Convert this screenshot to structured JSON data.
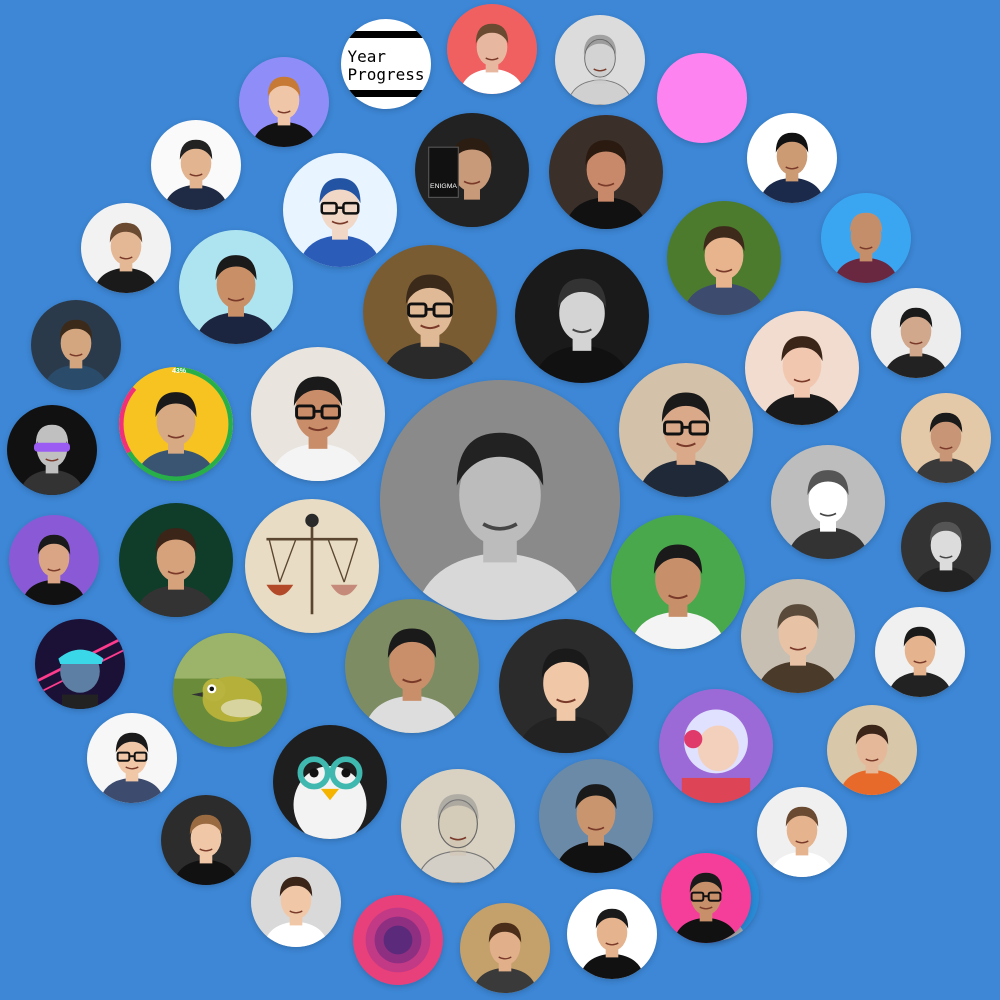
{
  "page": {
    "background": "#3d87d6"
  },
  "year_progress": {
    "line1": "Year",
    "line2": "Progress"
  },
  "ring_badge": "43%",
  "enigma_book": "ENIGMA",
  "avatars": [
    {
      "id": "center-portrait",
      "label": "profile-photo",
      "bg": "#8a8a8a",
      "skin": "#bcbcbc",
      "hair": "#222",
      "shirt": "#d8d8d8",
      "bw": true
    },
    {
      "id": "portrait-01",
      "bg": "#fafafa",
      "skin": "#e2b48f",
      "hair": "#222",
      "shirt": "#1f2b45"
    },
    {
      "id": "portrait-02",
      "bg": "#f06060",
      "skin": "#e7b7a0",
      "hair": "#6b4a32",
      "shirt": "#fff"
    },
    {
      "id": "portrait-03",
      "bg": "#dcdcdc",
      "skin": "#c9c9c9",
      "hair": "#666",
      "shirt": "#bbb",
      "sketch": true
    },
    {
      "id": "portrait-04",
      "bg": "#fc83f0",
      "flat": true
    },
    {
      "id": "portrait-05",
      "bg": "#8f8df7",
      "skin": "#f0c6a8",
      "hair": "#c77a35",
      "shirt": "#111"
    },
    {
      "id": "portrait-06",
      "bg": "#ffffff",
      "skin": "#cc9a73",
      "hair": "#111",
      "shirt": "#1b2a4a"
    },
    {
      "id": "portrait-07",
      "bg": "#e8f4ff",
      "skin": "#f1d7c6",
      "hair": "#2254a3",
      "shirt": "#2b5cb8",
      "glasses": true
    },
    {
      "id": "portrait-08",
      "bg": "#222",
      "skin": "#c99a7a",
      "hair": "#2b1d12",
      "shirt": "#222",
      "enigma": true
    },
    {
      "id": "portrait-09",
      "bg": "#3b2f2a",
      "skin": "#c7896a",
      "hair": "#2a1a10",
      "shirt": "#111"
    },
    {
      "id": "portrait-10",
      "bg": "#f2f2f2",
      "skin": "#e5b895",
      "hair": "#6b4a32",
      "shirt": "#1a1a1a"
    },
    {
      "id": "portrait-11",
      "bg": "#aee3f0",
      "skin": "#c99068",
      "hair": "#1a1a1a",
      "shirt": "#1c2540"
    },
    {
      "id": "portrait-12",
      "bg": "#7a5c33",
      "skin": "#e0b996",
      "hair": "#3b2a1a",
      "shirt": "#2a2a2a",
      "glasses": true
    },
    {
      "id": "portrait-13",
      "bg": "#1a1a1a",
      "skin": "#d4d4d4",
      "hair": "#333",
      "shirt": "#111",
      "bw": true
    },
    {
      "id": "portrait-14",
      "bg": "#4c7b2e",
      "skin": "#e7b48e",
      "hair": "#3d2a1a",
      "shirt": "#3d4c6e"
    },
    {
      "id": "portrait-15",
      "bg": "#3aa6f2",
      "skin": "#c58e6a",
      "hair": "#c58e6a",
      "shirt": "#6a2840"
    },
    {
      "id": "portrait-16",
      "bg": "#2b3a4a",
      "skin": "#d4a680",
      "hair": "#3b2a1a",
      "shirt": "#2a4b6a"
    },
    {
      "id": "portrait-17",
      "bg": "#ededed",
      "skin": "#d2a88c",
      "hair": "#1a1a1a",
      "shirt": "#222"
    },
    {
      "id": "portrait-18",
      "bg": "#f2dcd0",
      "skin": "#f1c7b0",
      "hair": "#3b2418",
      "shirt": "#1a1a1a"
    },
    {
      "id": "portrait-19",
      "bg": "#f6c321",
      "skin": "#d7aa84",
      "hair": "#1a1a1a",
      "shirt": "#3a5572",
      "ring": true
    },
    {
      "id": "portrait-20",
      "bg": "#e9e4dd",
      "skin": "#c98d6a",
      "hair": "#1a1a1a",
      "shirt": "#f4f4f4",
      "glasses": true
    },
    {
      "id": "portrait-21",
      "bg": "#111111",
      "skin": "#c0c0c0",
      "hair": "#c0c0c0",
      "shirt": "#333",
      "visor": true
    },
    {
      "id": "portrait-22",
      "bg": "#d3c1a9",
      "skin": "#d9a98a",
      "hair": "#1a1a1a",
      "shirt": "#1f2937",
      "glasses": true
    },
    {
      "id": "portrait-23",
      "bg": "#e4c9a8",
      "skin": "#c89676",
      "hair": "#1a1a1a",
      "shirt": "#3a3a3a"
    },
    {
      "id": "portrait-24",
      "bg": "#bdbdbd",
      "skin": "#ffffff",
      "hair": "#555",
      "shirt": "#333",
      "bw": true
    },
    {
      "id": "portrait-25",
      "bg": "#8a5ad6",
      "skin": "#d9a585",
      "hair": "#1a1a1a",
      "shirt": "#111"
    },
    {
      "id": "portrait-26",
      "bg": "#0f3d2a",
      "skin": "#d6a27c",
      "hair": "#3b2418",
      "shirt": "#333"
    },
    {
      "id": "portrait-27",
      "bg": "#e9dcc4",
      "scale": true
    },
    {
      "id": "portrait-28",
      "bg": "#333",
      "skin": "#dcdcdc",
      "hair": "#555",
      "shirt": "#222",
      "bw": true
    },
    {
      "id": "portrait-29",
      "bg": "#4aa84c",
      "skin": "#c8906a",
      "hair": "#1a1a1a",
      "shirt": "#f4f4f4"
    },
    {
      "id": "portrait-30",
      "bg": "#c8bfb3",
      "skin": "#e8c2a5",
      "hair": "#5a4a3a",
      "shirt": "#4a3a2a"
    },
    {
      "id": "portrait-31",
      "bg": "#f0f0f0",
      "skin": "#e5b38e",
      "hair": "#1a1a1a",
      "shirt": "#222"
    },
    {
      "id": "portrait-32",
      "bg": "#1b1035",
      "skin": "#5d7fa3",
      "hair": "#ff3b8d",
      "shirt": "#333",
      "neon": true
    },
    {
      "id": "portrait-33",
      "bg": "#7d8c63",
      "skin": "#c98f6a",
      "hair": "#1a1a1a",
      "shirt": "#ddd"
    },
    {
      "id": "portrait-34",
      "bg": "#2b2b2b",
      "skin": "#f0c8a8",
      "hair": "#1a1a1a",
      "shirt": "#222"
    },
    {
      "id": "portrait-35",
      "bg": "#6a8c3a",
      "bird": true
    },
    {
      "id": "portrait-36",
      "bg": "#d8c7a8",
      "skin": "#e5b89a",
      "hair": "#3b2418",
      "shirt": "#e86a2a"
    },
    {
      "id": "portrait-37",
      "bg": "#f7f7f7",
      "skin": "#f0c8a8",
      "hair": "#1a1a1a",
      "shirt": "#3d4c6e",
      "glasses": true
    },
    {
      "id": "portrait-38",
      "bg": "#9c6ad6",
      "skin": "#f3d0bc",
      "hair": "#e0e0ff",
      "shirt": "#d45",
      "anime": true
    },
    {
      "id": "portrait-39",
      "bg": "#1e1e1e",
      "penguin": true
    },
    {
      "id": "portrait-40",
      "bg": "#6a8aa8",
      "skin": "#c9956e",
      "hair": "#1a1a1a",
      "shirt": "#111"
    },
    {
      "id": "portrait-41",
      "bg": "#d9d2c3",
      "skin": "#d0c4b0",
      "hair": "#888",
      "shirt": "#ccc",
      "sketch": true
    },
    {
      "id": "portrait-42",
      "bg": "#2c2c2c",
      "skin": "#f0c8a8",
      "hair": "#9a6a40",
      "shirt": "#111"
    },
    {
      "id": "portrait-43",
      "bg": "#f0f0f0",
      "skin": "#e5b38e",
      "hair": "#6b4a32",
      "shirt": "#fff"
    },
    {
      "id": "portrait-44",
      "bg": "#2a8ad6",
      "skin": "#e8c2a5",
      "hair": "#333",
      "shirt": "#aaa",
      "glasses": true
    },
    {
      "id": "portrait-45",
      "bg": "#d9d9d9",
      "skin": "#f0c8a8",
      "hair": "#3b2418",
      "shirt": "#fff"
    },
    {
      "id": "portrait-46",
      "bg": "#e8407a",
      "target": true
    },
    {
      "id": "portrait-47",
      "bg": "#c4a06a",
      "skin": "#e1b08a",
      "hair": "#4a2e1a",
      "shirt": "#3a3a3a"
    },
    {
      "id": "portrait-48",
      "bg": "#ffffff",
      "skin": "#e5b38e",
      "hair": "#1a1a1a",
      "shirt": "#111"
    },
    {
      "id": "portrait-49",
      "bg": "#f53e9a",
      "skin": "#c8906a",
      "hair": "#1a1a1a",
      "shirt": "#111",
      "glasses": true
    },
    {
      "id": "portrait-50",
      "bg": "#101010",
      "skin": "#e0e0e0",
      "hair": "#333",
      "shirt": "#222",
      "stripes": true
    },
    {
      "id": "portrait-51",
      "bg": "#f5b7c9",
      "cartoon": true
    }
  ]
}
